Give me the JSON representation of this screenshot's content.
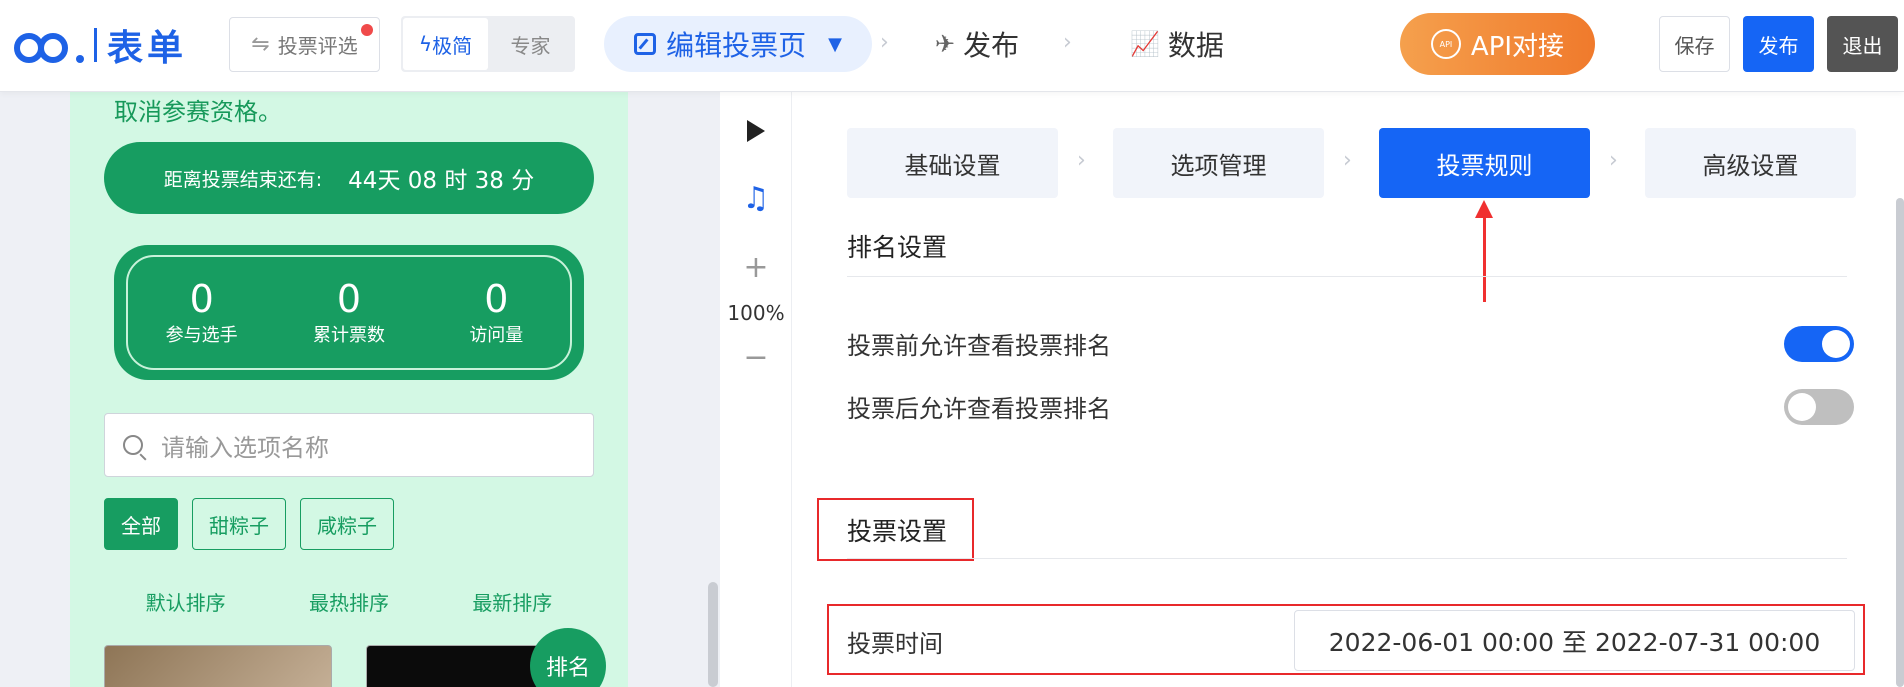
{
  "brand": {
    "logo_text": "表单"
  },
  "header": {
    "vote_select_label": "投票评选",
    "mode_simple": "极简",
    "mode_expert": "专家",
    "edit_page_label": "编辑投票页",
    "publish_step": "发布",
    "data_step": "数据",
    "api_label": "API对接",
    "save_label": "保存",
    "publish_label": "发布",
    "exit_label": "退出"
  },
  "preview": {
    "notice_tail": "取消参赛资格。",
    "countdown_label": "距离投票结束还有:",
    "countdown_value": "44天 08 时 38 分",
    "stats": [
      {
        "value": "0",
        "label": "参与选手"
      },
      {
        "value": "0",
        "label": "累计票数"
      },
      {
        "value": "0",
        "label": "访问量"
      }
    ],
    "search_placeholder": "请输入选项名称",
    "filters": [
      "全部",
      "甜粽子",
      "咸粽子"
    ],
    "sorts": [
      "默认排序",
      "最热排序",
      "最新排序"
    ],
    "rank_button": "排名"
  },
  "tools": {
    "zoom": "100%"
  },
  "settings": {
    "steps": [
      "基础设置",
      "选项管理",
      "投票规则",
      "高级设置"
    ],
    "active_step": "投票规则",
    "ranking_section": "排名设置",
    "allow_before_label": "投票前允许查看投票排名",
    "allow_before_on": true,
    "allow_after_label": "投票后允许查看投票排名",
    "allow_after_on": false,
    "vote_section": "投票设置",
    "vote_time_label": "投票时间",
    "vote_time_value": "2022-06-01 00:00 至 2022-07-31 00:00"
  },
  "colors": {
    "brand_blue": "#1e62e6",
    "primary_blue": "#1565f5",
    "preview_green": "#179d61",
    "preview_bg": "#d3f8e4",
    "annotation_red": "#e8292b"
  }
}
